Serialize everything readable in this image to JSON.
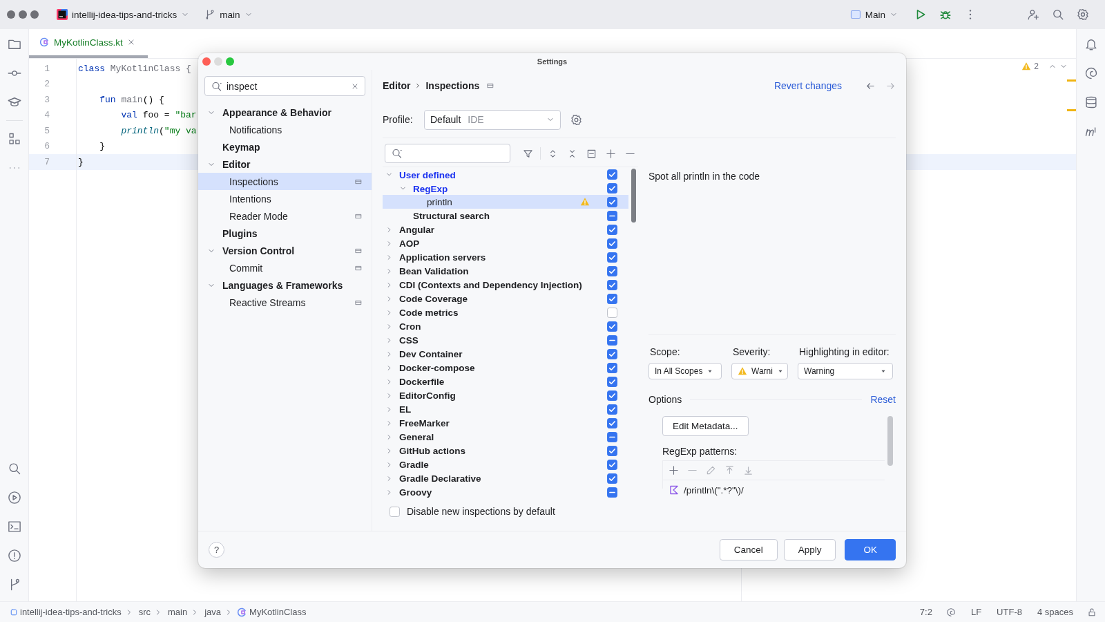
{
  "title_bar": {
    "project": "intellij-idea-tips-and-tricks",
    "branch": "main",
    "run_config": "Main"
  },
  "editor": {
    "tab": {
      "label": "MyKotlinClass.kt",
      "selected": true
    },
    "lines": [
      {
        "number": "1",
        "current": false,
        "tokens": [
          {
            "kind": "keyword",
            "text": "class"
          },
          {
            "kind": "ident",
            "text": " MyKotlinClass {"
          }
        ]
      },
      {
        "number": "2",
        "current": false
      },
      {
        "number": "3",
        "current": false,
        "tokens": [
          {
            "kind": "keyword",
            "text": "    fun"
          },
          {
            "kind": "ident",
            "text": " main"
          },
          {
            "kind": "plain",
            "text": "() {"
          }
        ]
      },
      {
        "number": "4",
        "current": false,
        "tokens": [
          {
            "kind": "keyword",
            "text": "        val"
          },
          {
            "kind": "plain",
            "text": " foo = "
          },
          {
            "kind": "string",
            "text": "\"bar"
          }
        ]
      },
      {
        "number": "5",
        "current": false,
        "tokens": [
          {
            "kind": "call",
            "text": "        println"
          },
          {
            "kind": "plain",
            "text": "("
          },
          {
            "kind": "string",
            "text": "\"my va"
          }
        ]
      },
      {
        "number": "6",
        "current": false,
        "tokens": [
          {
            "kind": "plain",
            "text": "    }"
          }
        ]
      },
      {
        "number": "7",
        "current": true,
        "tokens": [
          {
            "kind": "plain",
            "text": "}"
          }
        ]
      }
    ],
    "problems": {
      "count": "2"
    }
  },
  "settings": {
    "title": "Settings",
    "search": {
      "value": "inspect"
    },
    "nav": [
      {
        "label": "Appearance & Behavior",
        "expanded": true,
        "selected": false,
        "badge": false,
        "children": [
          {
            "label": "Notifications",
            "selected": false,
            "badge": false
          }
        ]
      },
      {
        "label": "Keymap",
        "selected": false,
        "badge": false
      },
      {
        "label": "Editor",
        "expanded": true,
        "selected": false,
        "badge": false,
        "children": [
          {
            "label": "Inspections",
            "selected": true,
            "badge": true
          },
          {
            "label": "Intentions",
            "selected": false,
            "badge": false
          },
          {
            "label": "Reader Mode",
            "selected": false,
            "badge": true
          }
        ]
      },
      {
        "label": "Plugins",
        "selected": false,
        "badge": false
      },
      {
        "label": "Version Control",
        "expanded": true,
        "selected": false,
        "badge": true,
        "children": [
          {
            "label": "Commit",
            "selected": false,
            "badge": true
          }
        ]
      },
      {
        "label": "Languages & Frameworks",
        "expanded": true,
        "selected": false,
        "badge": false,
        "children": [
          {
            "label": "Reactive Streams",
            "selected": false,
            "badge": true
          }
        ]
      }
    ],
    "breadcrumb": [
      "Editor",
      "Inspections"
    ],
    "revert": "Revert changes",
    "profile": {
      "label": "Profile:",
      "value": "Default",
      "scope": "IDE"
    },
    "inspections": [
      {
        "label": "User defined",
        "kind": "group",
        "expanded": true,
        "modified": true,
        "selected": false,
        "checked": true,
        "mixed": false,
        "warning": false,
        "children": [
          {
            "label": "RegExp",
            "kind": "group",
            "expanded": true,
            "modified": true,
            "selected": false,
            "checked": true,
            "mixed": false,
            "warning": false,
            "children": [
              {
                "label": "println",
                "kind": "leaf",
                "modified": false,
                "selected": true,
                "checked": true,
                "mixed": false,
                "warning": true
              }
            ]
          },
          {
            "label": "Structural search",
            "kind": "group",
            "modified": false,
            "selected": false,
            "mixed": true,
            "warning": false
          }
        ]
      },
      {
        "label": "Angular",
        "kind": "group",
        "expanded": false,
        "modified": false,
        "selected": false,
        "checked": true,
        "mixed": false,
        "warning": false
      },
      {
        "label": "AOP",
        "kind": "group",
        "expanded": false,
        "modified": false,
        "selected": false,
        "checked": true,
        "mixed": false,
        "warning": false
      },
      {
        "label": "Application servers",
        "kind": "group",
        "expanded": false,
        "modified": false,
        "selected": false,
        "checked": true,
        "mixed": false,
        "warning": false
      },
      {
        "label": "Bean Validation",
        "kind": "group",
        "expanded": false,
        "modified": false,
        "selected": false,
        "checked": true,
        "mixed": false,
        "warning": false
      },
      {
        "label": "CDI (Contexts and Dependency Injection)",
        "kind": "group",
        "expanded": false,
        "modified": false,
        "selected": false,
        "checked": true,
        "mixed": false,
        "warning": false
      },
      {
        "label": "Code Coverage",
        "kind": "group",
        "expanded": false,
        "modified": false,
        "selected": false,
        "checked": true,
        "mixed": false,
        "warning": false
      },
      {
        "label": "Code metrics",
        "kind": "group",
        "expanded": false,
        "modified": false,
        "selected": false,
        "checked": false,
        "mixed": false,
        "warning": false
      },
      {
        "label": "Cron",
        "kind": "group",
        "expanded": false,
        "modified": false,
        "selected": false,
        "checked": true,
        "mixed": false,
        "warning": false
      },
      {
        "label": "CSS",
        "kind": "group",
        "expanded": false,
        "modified": false,
        "selected": false,
        "mixed": true,
        "warning": false
      },
      {
        "label": "Dev Container",
        "kind": "group",
        "expanded": false,
        "modified": false,
        "selected": false,
        "checked": true,
        "mixed": false,
        "warning": false
      },
      {
        "label": "Docker-compose",
        "kind": "group",
        "expanded": false,
        "modified": false,
        "selected": false,
        "checked": true,
        "mixed": false,
        "warning": false
      },
      {
        "label": "Dockerfile",
        "kind": "group",
        "expanded": false,
        "modified": false,
        "selected": false,
        "checked": true,
        "mixed": false,
        "warning": false
      },
      {
        "label": "EditorConfig",
        "kind": "group",
        "expanded": false,
        "modified": false,
        "selected": false,
        "checked": true,
        "mixed": false,
        "warning": false
      },
      {
        "label": "EL",
        "kind": "group",
        "expanded": false,
        "modified": false,
        "selected": false,
        "checked": true,
        "mixed": false,
        "warning": false
      },
      {
        "label": "FreeMarker",
        "kind": "group",
        "expanded": false,
        "modified": false,
        "selected": false,
        "checked": true,
        "mixed": false,
        "warning": false
      },
      {
        "label": "General",
        "kind": "group",
        "expanded": false,
        "modified": false,
        "selected": false,
        "mixed": true,
        "warning": false
      },
      {
        "label": "GitHub actions",
        "kind": "group",
        "expanded": false,
        "modified": false,
        "selected": false,
        "checked": true,
        "mixed": false,
        "warning": false
      },
      {
        "label": "Gradle",
        "kind": "group",
        "expanded": false,
        "modified": false,
        "selected": false,
        "checked": true,
        "mixed": false,
        "warning": false
      },
      {
        "label": "Gradle Declarative",
        "kind": "group",
        "expanded": false,
        "modified": false,
        "selected": false,
        "checked": true,
        "mixed": false,
        "warning": false
      },
      {
        "label": "Groovy",
        "kind": "group",
        "expanded": false,
        "modified": false,
        "selected": false,
        "mixed": true,
        "warning": false
      }
    ],
    "disable_new": {
      "label": "Disable new inspections by default",
      "checked": false
    },
    "description": "Spot all println in the code",
    "scope": {
      "label": "Scope:",
      "value": "In All Scopes"
    },
    "severity": {
      "label": "Severity:",
      "value": "Warni",
      "warning": true
    },
    "highlighting": {
      "label": "Highlighting in editor:",
      "value": "Warning"
    },
    "options": {
      "title": "Options",
      "reset": "Reset",
      "edit_button": "Edit Metadata...",
      "patterns_label": "RegExp patterns:",
      "patterns": [
        "/println\\(\".*?\"\\)/"
      ]
    },
    "help": "?",
    "buttons": [
      {
        "label": "Cancel",
        "primary": false
      },
      {
        "label": "Apply",
        "primary": false
      },
      {
        "label": "OK",
        "primary": true
      }
    ]
  },
  "status_bar": {
    "path": [
      "intellij-idea-tips-and-tricks",
      "src",
      "main",
      "java",
      "MyKotlinClass"
    ],
    "position": "7:2",
    "line_ending": "LF",
    "encoding": "UTF-8",
    "indent": "4 spaces"
  }
}
